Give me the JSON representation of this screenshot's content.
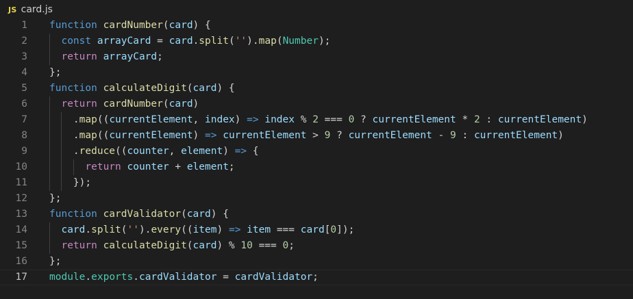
{
  "tab": {
    "icon_label": "JS",
    "file_name": "card.js"
  },
  "colors": {
    "background": "#1e1e1e",
    "keyword": "#569cd6",
    "control": "#c586c0",
    "function": "#dcdcaa",
    "variable": "#9cdcfe",
    "number": "#b5cea8",
    "string": "#ce9178",
    "type": "#4ec9b0",
    "line_number": "#858585"
  },
  "current_line": 17,
  "lines": [
    {
      "n": "1",
      "tokens": [
        [
          "k",
          "function "
        ],
        [
          "f",
          "cardNumber"
        ],
        [
          "p",
          "("
        ],
        [
          "v",
          "card"
        ],
        [
          "p",
          ") {"
        ]
      ]
    },
    {
      "n": "2",
      "tokens": [
        [
          "p",
          "  "
        ],
        [
          "k",
          "const "
        ],
        [
          "v",
          "arrayCard"
        ],
        [
          "p",
          " = "
        ],
        [
          "v",
          "card"
        ],
        [
          "p",
          "."
        ],
        [
          "f",
          "split"
        ],
        [
          "p",
          "("
        ],
        [
          "s",
          "''"
        ],
        [
          "p",
          ")."
        ],
        [
          "f",
          "map"
        ],
        [
          "p",
          "("
        ],
        [
          "t",
          "Number"
        ],
        [
          "p",
          ");"
        ]
      ]
    },
    {
      "n": "3",
      "tokens": [
        [
          "p",
          "  "
        ],
        [
          "c",
          "return "
        ],
        [
          "v",
          "arrayCard"
        ],
        [
          "p",
          ";"
        ]
      ]
    },
    {
      "n": "4",
      "tokens": [
        [
          "p",
          "};"
        ]
      ]
    },
    {
      "n": "5",
      "tokens": [
        [
          "k",
          "function "
        ],
        [
          "f",
          "calculateDigit"
        ],
        [
          "p",
          "("
        ],
        [
          "v",
          "card"
        ],
        [
          "p",
          ") {"
        ]
      ]
    },
    {
      "n": "6",
      "tokens": [
        [
          "p",
          "  "
        ],
        [
          "c",
          "return "
        ],
        [
          "f",
          "cardNumber"
        ],
        [
          "p",
          "("
        ],
        [
          "v",
          "card"
        ],
        [
          "p",
          ")"
        ]
      ]
    },
    {
      "n": "7",
      "tokens": [
        [
          "p",
          "    ."
        ],
        [
          "f",
          "map"
        ],
        [
          "p",
          "(("
        ],
        [
          "v",
          "currentElement"
        ],
        [
          "p",
          ", "
        ],
        [
          "v",
          "index"
        ],
        [
          "p",
          ") "
        ],
        [
          "o",
          "=>"
        ],
        [
          "p",
          " "
        ],
        [
          "v",
          "index"
        ],
        [
          "p",
          " % "
        ],
        [
          "n",
          "2"
        ],
        [
          "p",
          " === "
        ],
        [
          "n",
          "0"
        ],
        [
          "p",
          " ? "
        ],
        [
          "v",
          "currentElement"
        ],
        [
          "p",
          " * "
        ],
        [
          "n",
          "2"
        ],
        [
          "p",
          " : "
        ],
        [
          "v",
          "currentElement"
        ],
        [
          "p",
          ")"
        ]
      ]
    },
    {
      "n": "8",
      "tokens": [
        [
          "p",
          "    ."
        ],
        [
          "f",
          "map"
        ],
        [
          "p",
          "(("
        ],
        [
          "v",
          "currentElement"
        ],
        [
          "p",
          ") "
        ],
        [
          "o",
          "=>"
        ],
        [
          "p",
          " "
        ],
        [
          "v",
          "currentElement"
        ],
        [
          "p",
          " > "
        ],
        [
          "n",
          "9"
        ],
        [
          "p",
          " ? "
        ],
        [
          "v",
          "currentElement"
        ],
        [
          "p",
          " - "
        ],
        [
          "n",
          "9"
        ],
        [
          "p",
          " : "
        ],
        [
          "v",
          "currentElement"
        ],
        [
          "p",
          ")"
        ]
      ]
    },
    {
      "n": "9",
      "tokens": [
        [
          "p",
          "    ."
        ],
        [
          "f",
          "reduce"
        ],
        [
          "p",
          "(("
        ],
        [
          "v",
          "counter"
        ],
        [
          "p",
          ", "
        ],
        [
          "v",
          "element"
        ],
        [
          "p",
          ") "
        ],
        [
          "o",
          "=>"
        ],
        [
          "p",
          " {"
        ]
      ]
    },
    {
      "n": "10",
      "tokens": [
        [
          "p",
          "      "
        ],
        [
          "c",
          "return "
        ],
        [
          "v",
          "counter"
        ],
        [
          "p",
          " + "
        ],
        [
          "v",
          "element"
        ],
        [
          "p",
          ";"
        ]
      ]
    },
    {
      "n": "11",
      "tokens": [
        [
          "p",
          "    });"
        ]
      ]
    },
    {
      "n": "12",
      "tokens": [
        [
          "p",
          "};"
        ]
      ]
    },
    {
      "n": "13",
      "tokens": [
        [
          "k",
          "function "
        ],
        [
          "f",
          "cardValidator"
        ],
        [
          "p",
          "("
        ],
        [
          "v",
          "card"
        ],
        [
          "p",
          ") {"
        ]
      ]
    },
    {
      "n": "14",
      "tokens": [
        [
          "p",
          "  "
        ],
        [
          "v",
          "card"
        ],
        [
          "p",
          "."
        ],
        [
          "f",
          "split"
        ],
        [
          "p",
          "("
        ],
        [
          "s",
          "''"
        ],
        [
          "p",
          ")."
        ],
        [
          "f",
          "every"
        ],
        [
          "p",
          "(("
        ],
        [
          "v",
          "item"
        ],
        [
          "p",
          ") "
        ],
        [
          "o",
          "=>"
        ],
        [
          "p",
          " "
        ],
        [
          "v",
          "item"
        ],
        [
          "p",
          " === "
        ],
        [
          "v",
          "card"
        ],
        [
          "p",
          "["
        ],
        [
          "n",
          "0"
        ],
        [
          "p",
          "]);"
        ]
      ]
    },
    {
      "n": "15",
      "tokens": [
        [
          "p",
          "  "
        ],
        [
          "c",
          "return "
        ],
        [
          "f",
          "calculateDigit"
        ],
        [
          "p",
          "("
        ],
        [
          "v",
          "card"
        ],
        [
          "p",
          ") % "
        ],
        [
          "n",
          "10"
        ],
        [
          "p",
          " === "
        ],
        [
          "n",
          "0"
        ],
        [
          "p",
          ";"
        ]
      ]
    },
    {
      "n": "16",
      "tokens": [
        [
          "p",
          "};"
        ]
      ]
    },
    {
      "n": "17",
      "tokens": [
        [
          "t",
          "module"
        ],
        [
          "p",
          "."
        ],
        [
          "t",
          "exports"
        ],
        [
          "p",
          "."
        ],
        [
          "v",
          "cardValidator"
        ],
        [
          "p",
          " = "
        ],
        [
          "v",
          "cardValidator"
        ],
        [
          "p",
          ";"
        ]
      ]
    }
  ]
}
